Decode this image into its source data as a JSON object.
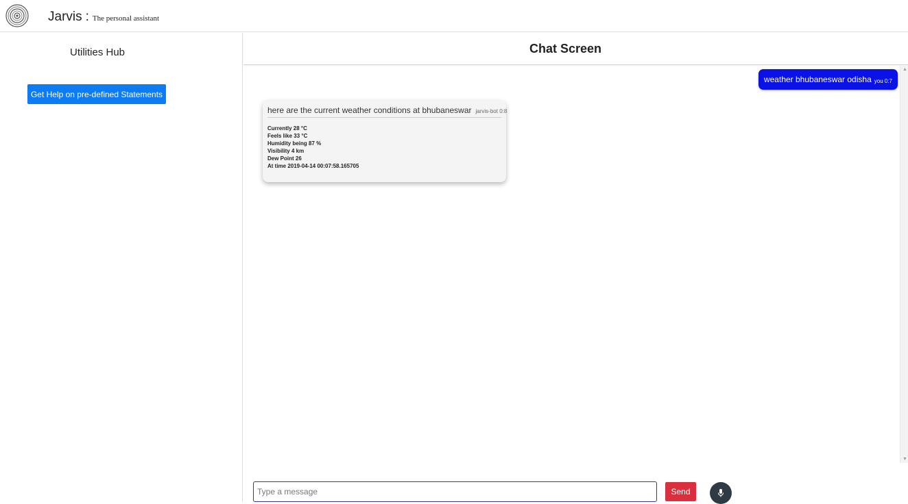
{
  "header": {
    "logo_icon": "spiral-logo-icon",
    "brand_name": "Jarvis",
    "separator": ":",
    "tagline": "The personal assistant"
  },
  "sidebar": {
    "title": "Utilities Hub",
    "help_button_label": "Get Help on pre-defined Statements"
  },
  "chat": {
    "title": "Chat Screen",
    "messages": [
      {
        "sender": "user",
        "text": "weather bhubaneswar odisha",
        "meta": "you 0:7"
      },
      {
        "sender": "bot",
        "text": "here are the current weather conditions at bhubaneswar",
        "meta": "jarvis-bot 0:8",
        "details": [
          "Currently 28 °C",
          "Feels like 33 °C",
          "Humidity being 87 %",
          "Visibility 4 km",
          "Dew Point 26",
          "At time 2019-04-14 00:07:58.165705"
        ]
      }
    ]
  },
  "composer": {
    "placeholder": "Type a message",
    "value": "",
    "send_label": "Send",
    "mic_icon": "microphone-icon"
  },
  "colors": {
    "help_button": "#0d7bf2",
    "user_bubble": "#0a12e6",
    "send_button": "#d9303f",
    "mic_button": "#2f3a45"
  }
}
